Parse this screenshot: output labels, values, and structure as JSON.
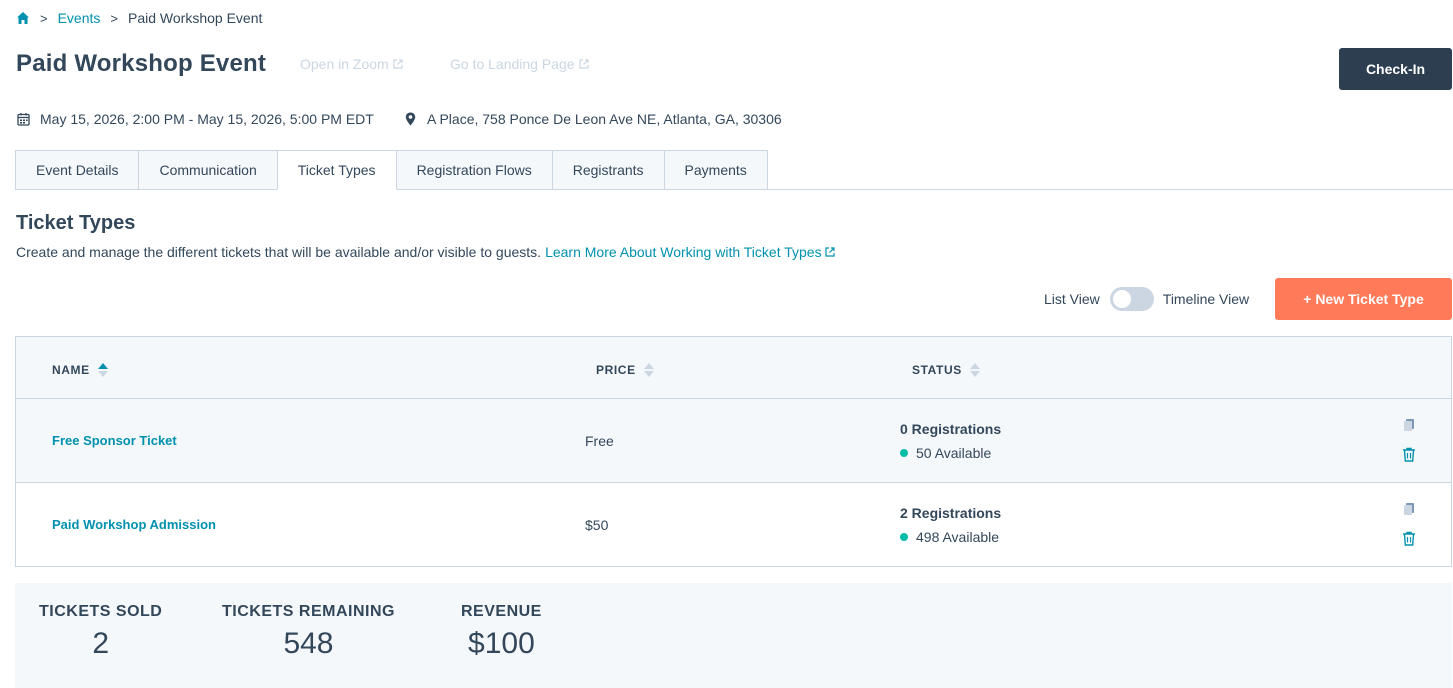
{
  "breadcrumb": {
    "events": "Events",
    "current": "Paid Workshop Event",
    "separator": ">"
  },
  "header": {
    "title": "Paid Workshop Event",
    "open_zoom": "Open in Zoom",
    "landing_page": "Go to Landing Page",
    "checkin_label": "Check-In"
  },
  "meta": {
    "datetime": "May 15, 2026, 2:00 PM - May 15, 2026, 5:00 PM EDT",
    "location": "A Place, 758 Ponce De Leon Ave NE, Atlanta, GA, 30306"
  },
  "tabs": [
    {
      "label": "Event Details"
    },
    {
      "label": "Communication"
    },
    {
      "label": "Ticket Types"
    },
    {
      "label": "Registration Flows"
    },
    {
      "label": "Registrants"
    },
    {
      "label": "Payments"
    }
  ],
  "section": {
    "title": "Ticket Types",
    "description": "Create and manage the different tickets that will be available and/or visible to guests.",
    "learn_more": "Learn More About Working with Ticket Types"
  },
  "view_toggle": {
    "list": "List View",
    "timeline": "Timeline View"
  },
  "new_ticket_label": "+ New Ticket Type",
  "table": {
    "columns": {
      "name": "NAME",
      "price": "PRICE",
      "status": "STATUS"
    },
    "rows": [
      {
        "name": "Free Sponsor Ticket",
        "price": "Free",
        "registrations": "0 Registrations",
        "available": "50 Available"
      },
      {
        "name": "Paid Workshop Admission",
        "price": "$50",
        "registrations": "2 Registrations",
        "available": "498 Available"
      }
    ]
  },
  "summary": {
    "sold_label": "TICKETS SOLD",
    "sold_value": "2",
    "remaining_label": "TICKETS REMAINING",
    "remaining_value": "548",
    "revenue_label": "REVENUE",
    "revenue_value": "$100"
  },
  "colors": {
    "teal": "#0091ae",
    "orange": "#ff7a59",
    "navy": "#2d3e50",
    "green": "#00bda5"
  }
}
